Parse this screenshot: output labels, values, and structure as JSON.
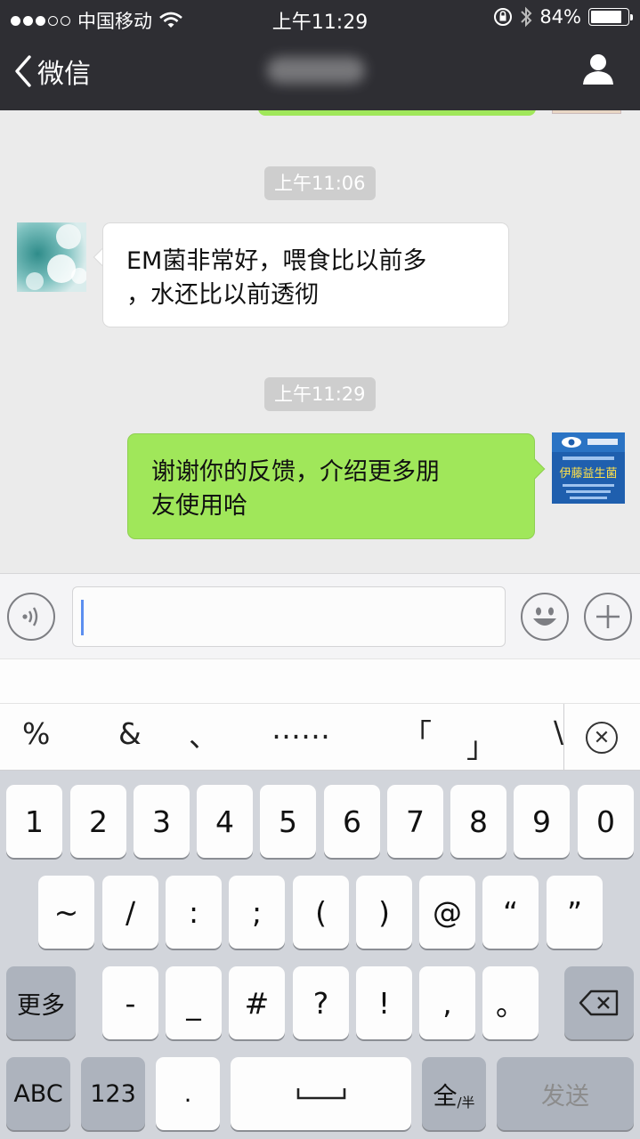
{
  "status_bar": {
    "carrier": "中国移动",
    "time": "上午11:29",
    "battery_percent": "84%",
    "battery_level": 0.84
  },
  "nav": {
    "back_label": "微信"
  },
  "chat": {
    "messages": [
      {
        "timestamp": "上午11:06",
        "direction": "incoming",
        "lines": [
          "EM菌非常好，喂食比以前多",
          "，水还比以前透彻"
        ]
      },
      {
        "timestamp": "上午11:29",
        "direction": "outgoing",
        "lines": [
          "谢谢你的反馈，介绍更多朋",
          "友使用哈"
        ]
      }
    ],
    "outgoing_avatar_brand": "伊藤益生菌"
  },
  "input": {
    "value": ""
  },
  "candidates": [
    "%",
    "&",
    "、",
    "……",
    "「",
    "」",
    "\\"
  ],
  "keyboard": {
    "row1": [
      "1",
      "2",
      "3",
      "4",
      "5",
      "6",
      "7",
      "8",
      "9",
      "0"
    ],
    "row2": [
      "~",
      "/",
      ":",
      ";",
      "(",
      ")",
      "@",
      "“",
      "”"
    ],
    "row3_left": "更多",
    "row3": [
      "-",
      "_",
      "#",
      "?",
      "!",
      ",",
      "。"
    ],
    "row4": {
      "abc": "ABC",
      "num": "123",
      "dot": ".",
      "full_half": "全",
      "full_half_sub": "/半",
      "send": "发送"
    }
  },
  "colors": {
    "nav_bg": "#2e2e33",
    "chat_bg": "#ebebeb",
    "outgoing_bubble": "#a0e75a",
    "incoming_bubble": "#ffffff",
    "keyboard_bg": "#d2d5db"
  }
}
